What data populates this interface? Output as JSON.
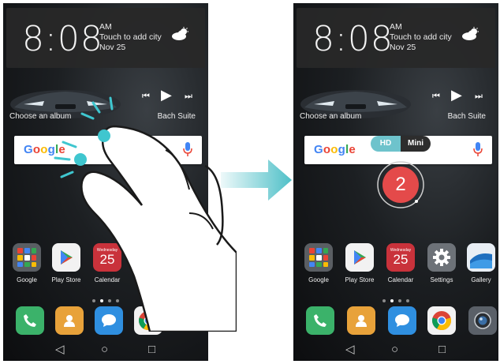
{
  "left_screen": {
    "clock": {
      "time": "8:08",
      "line1": "AM",
      "line2": "Touch to add city",
      "line3": "Nov 25"
    },
    "music": {
      "album": "Choose an album",
      "track": "Bach Suite"
    },
    "search": {
      "logo": [
        "G",
        "o",
        "o",
        "g",
        "l",
        "e"
      ]
    },
    "apps": [
      {
        "label": "Google",
        "icon": "folder-icon"
      },
      {
        "label": "Play Store",
        "icon": "play-store-icon"
      },
      {
        "label": "Calendar",
        "icon": "calendar-icon",
        "day": "Wednesday",
        "date": "25"
      }
    ],
    "dock": [
      "phone-icon",
      "contacts-icon",
      "messages-icon",
      "chrome-icon"
    ]
  },
  "right_screen": {
    "clock": {
      "time": "8:08",
      "line1": "AM",
      "line2": "Touch to add city",
      "line3": "Nov 25"
    },
    "music": {
      "album": "Choose an album",
      "track": "Bach Suite"
    },
    "toggle": {
      "hd": "HD",
      "mini": "Mini"
    },
    "countdown": "2",
    "apps": [
      {
        "label": "Google",
        "icon": "folder-icon"
      },
      {
        "label": "Play Store",
        "icon": "play-store-icon"
      },
      {
        "label": "Calendar",
        "icon": "calendar-icon",
        "day": "Wednesday",
        "date": "25"
      },
      {
        "label": "Settings",
        "icon": "settings-icon"
      },
      {
        "label": "Gallery",
        "icon": "gallery-icon"
      }
    ],
    "dock": [
      "phone-icon",
      "contacts-icon",
      "messages-icon",
      "chrome-icon",
      "camera-icon"
    ]
  },
  "colors": {
    "accent_teal": "#4fc0c8",
    "record_red": "#e44a4a",
    "hd_teal": "#6ec3cc"
  }
}
